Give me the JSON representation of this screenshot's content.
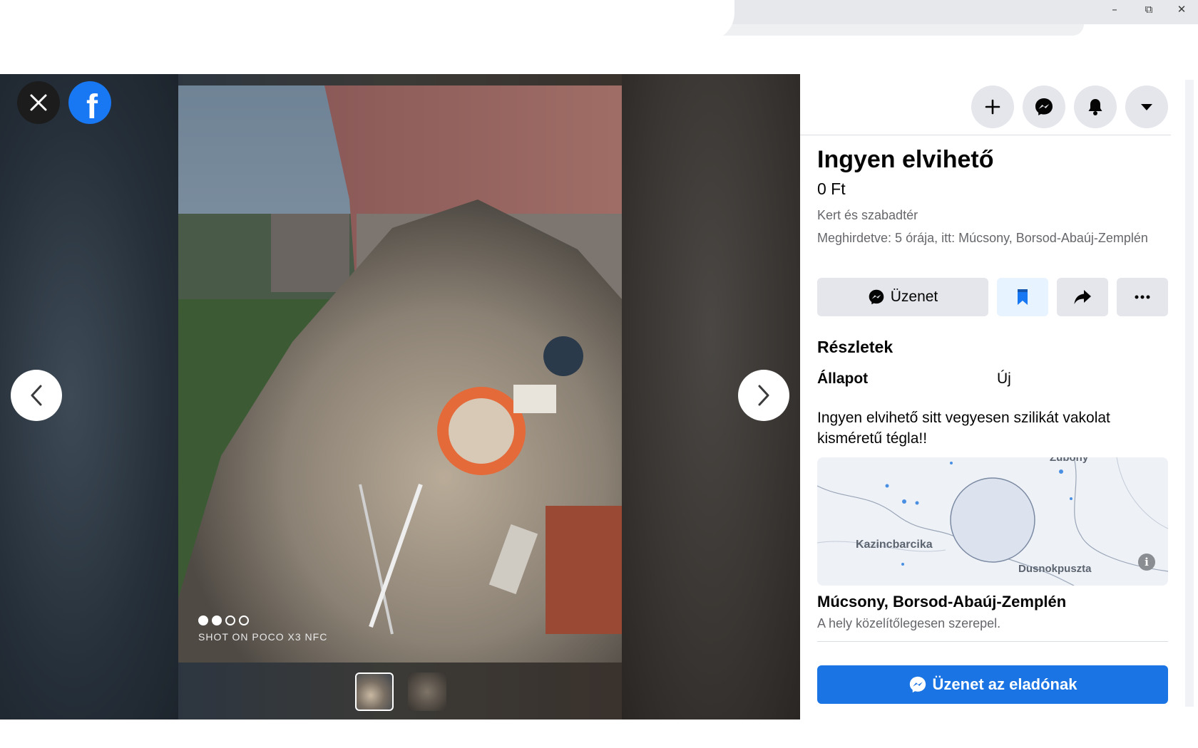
{
  "window": {
    "minimize_icon": "minimize-icon",
    "restore_icon": "restore-icon",
    "close_icon": "close-icon"
  },
  "viewer": {
    "close_icon": "close-icon",
    "logo_icon": "facebook-logo-icon",
    "logo_letter": "f",
    "prev_icon": "chevron-left-icon",
    "next_icon": "chevron-right-icon",
    "photo_overlay": {
      "dots_active": 2,
      "dots_total": 4,
      "watermark": "SHOT ON POCO X3 NFC"
    },
    "thumbnails": [
      {
        "state": "active"
      },
      {
        "state": "inactive"
      }
    ]
  },
  "topnav": {
    "icons": [
      "plus-icon",
      "messenger-icon",
      "bell-icon",
      "caret-down-icon"
    ]
  },
  "listing": {
    "title": "Ingyen elvihető",
    "price": "0 Ft",
    "category": "Kert és szabadtér",
    "posted": "Meghirdetve: 5 órája, itt: Múcsony, Borsod-Abaúj-Zemplén",
    "actions": {
      "message_label": "Üzenet",
      "message_icon": "messenger-icon",
      "save_icon": "bookmark-icon",
      "share_icon": "share-icon",
      "more_icon": "more-horizontal-icon"
    },
    "details_heading": "Részletek",
    "condition_label": "Állapot",
    "condition_value": "Új",
    "description": "Ingyen elvihető sitt vegyesen szilikát vakolat kisméretű tégla!!",
    "map": {
      "labels": {
        "city_left": "Kazincbarcika",
        "city_right": "Dusnokpuszta",
        "city_top": "Zubony"
      },
      "info_icon": "info-icon",
      "info_glyph": "i"
    },
    "location_name": "Múcsony, Borsod-Abaúj-Zemplén",
    "location_note": "A hely közelítőlegesen szerepel.",
    "message_seller_label": "Üzenet az eladónak"
  },
  "colors": {
    "brand": "#1877f2",
    "primary_button": "#1b74e4",
    "secondary_button": "#e4e6eb",
    "save_button": "#e7f3ff"
  }
}
